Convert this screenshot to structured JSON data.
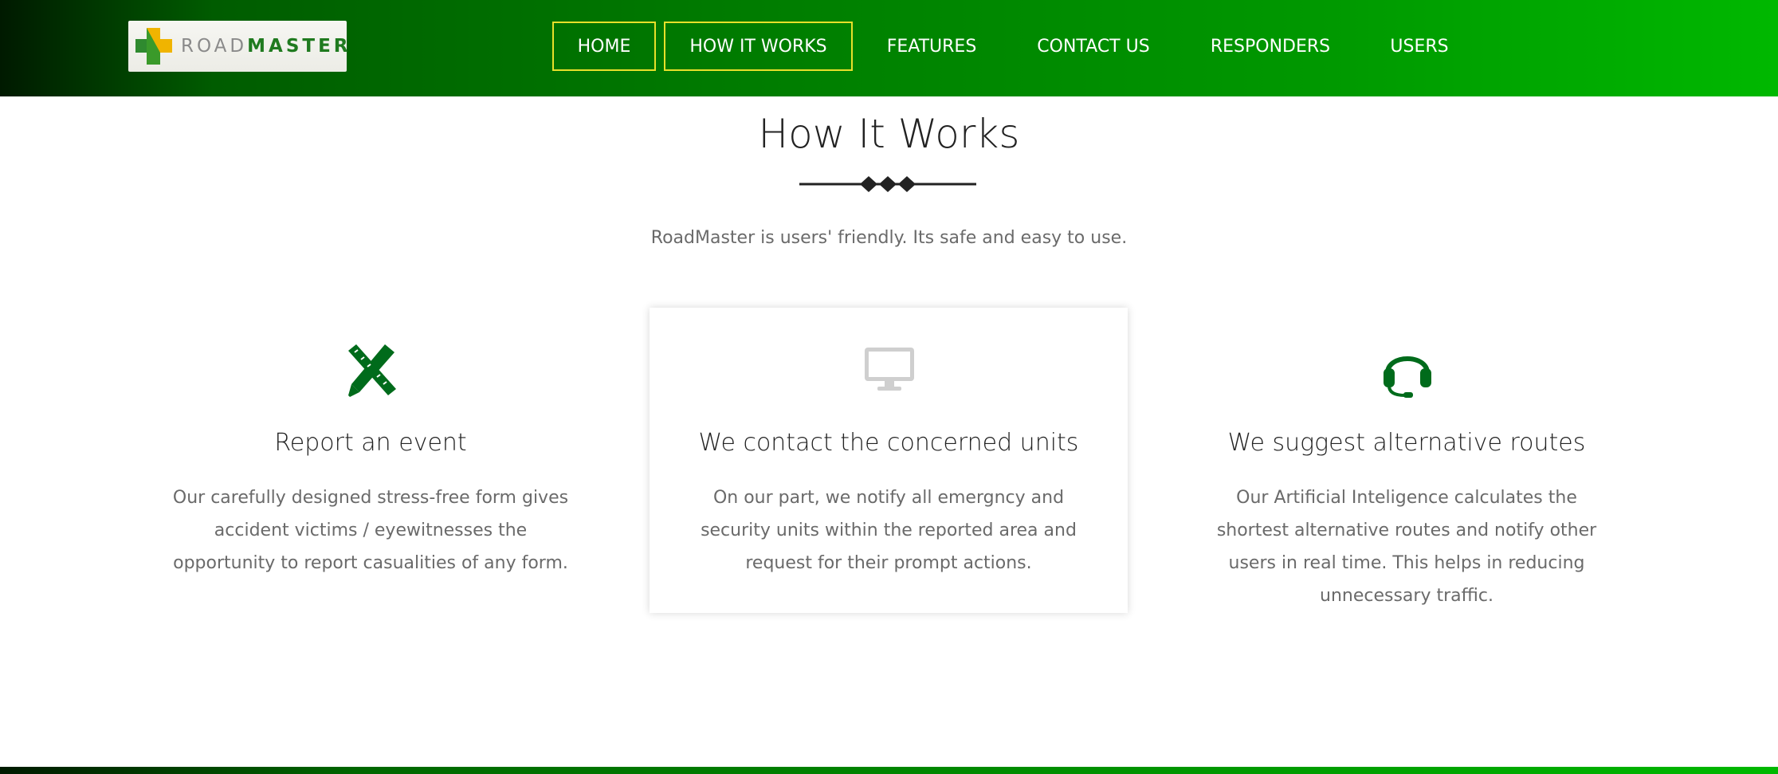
{
  "brand": {
    "logo_road": "ROAD",
    "logo_master": "MASTER",
    "colors": {
      "primary_green": "#006600",
      "accent_yellow": "#e8e02a",
      "icon_green": "#006b1b"
    }
  },
  "nav": {
    "items": [
      {
        "label": "HOME",
        "boxed": true
      },
      {
        "label": "HOW IT WORKS",
        "boxed": true
      },
      {
        "label": "FEATURES"
      },
      {
        "label": "CONTACT US"
      },
      {
        "label": "RESPONDERS"
      },
      {
        "label": "USERS"
      }
    ]
  },
  "section": {
    "title": "How It Works",
    "subtitle": "RoadMaster is users' friendly. Its safe and easy to use."
  },
  "cards": [
    {
      "icon": "pencil-ruler-icon",
      "title": "Report an event",
      "text": "Our carefully designed stress-free form gives accident victims / eyewitnesses the opportunity to report casualities of any form."
    },
    {
      "icon": "monitor-icon",
      "title": "We contact the concerned units",
      "text": "On our part, we notify all emergncy and security units within the reported area and request for their prompt actions."
    },
    {
      "icon": "headset-icon",
      "title": "We suggest alternative routes",
      "text": "Our Artificial Inteligence calculates the shortest alternative routes and notify other users in real time. This helps in reducing unnecessary traffic."
    }
  ]
}
